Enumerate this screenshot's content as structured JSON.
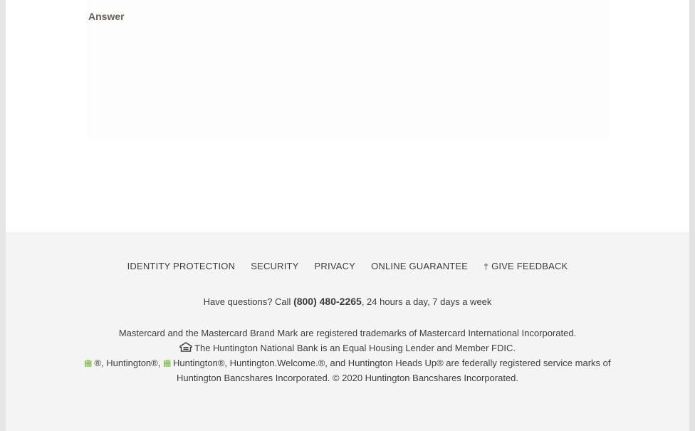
{
  "main": {
    "answer_heading": "Answer"
  },
  "footer": {
    "nav": [
      {
        "label": "IDENTITY PROTECTION"
      },
      {
        "label": "SECURITY"
      },
      {
        "label": "PRIVACY"
      },
      {
        "label": "ONLINE GUARANTEE"
      },
      {
        "label": "GIVE FEEDBACK",
        "icon": "feedback-icon"
      }
    ],
    "contact": {
      "prefix": "Have questions? Call ",
      "phone": "(800) 480-2265",
      "suffix": ", 24 hours a day, 7 days a week"
    },
    "legal": {
      "mastercard": "Mastercard and the Mastercard Brand Mark are registered trademarks of Mastercard International Incorporated.",
      "equal_housing": "The Huntington National Bank is an Equal Housing Lender and Member FDIC.",
      "marks_part1": "®, Huntington®, ",
      "marks_part2": "Huntington®, Huntington.Welcome.®, and Huntington Heads Up® are federally registered service marks of",
      "copyright": "Huntington Bancshares Incorporated. © 2020 Huntington Bancshares Incorporated."
    },
    "icons": {
      "equal_housing": "equal-housing-icon",
      "huntington_logo": "huntington-logo-icon"
    },
    "colors": {
      "brand_green": "#7ac143",
      "footer_bg": "#f4f4f4",
      "text": "#3d3d3d"
    }
  }
}
